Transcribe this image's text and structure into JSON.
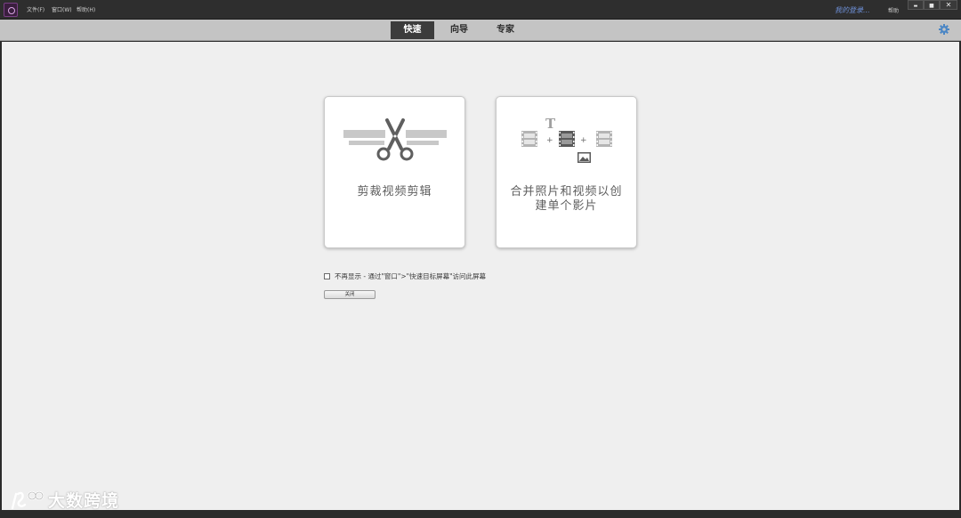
{
  "titlebar": {
    "menu": {
      "file": "文件(F)",
      "window": "窗口(W)",
      "help": "帮助(H)"
    },
    "user_link": "我的登录...",
    "help_link": "帮助",
    "window_buttons": {
      "minimize": "▬",
      "maximize": "■",
      "close": "✕"
    }
  },
  "modes": {
    "quick": "快速",
    "guided": "向导",
    "expert": "专家",
    "active": "quick"
  },
  "cards": {
    "trim": {
      "label": "剪裁视频剪辑",
      "icon": "scissors-icon"
    },
    "merge": {
      "label": "合并照片和视频以创建单个影片",
      "icon": "merge-media-icon"
    }
  },
  "dont_show": {
    "text": "不再显示 - 通过\"窗口\">\"快速目标屏幕\"访问此屏幕",
    "checked": false
  },
  "close_button": "关闭",
  "watermark": "大数跨境",
  "colors": {
    "titlebar": "#2e2e2e",
    "modebar": "#c4c4c4",
    "active_tab": "#3c3c3c",
    "main_bg": "#efefef",
    "user_link": "#6d8fd6",
    "gear": "#4a86c5"
  }
}
